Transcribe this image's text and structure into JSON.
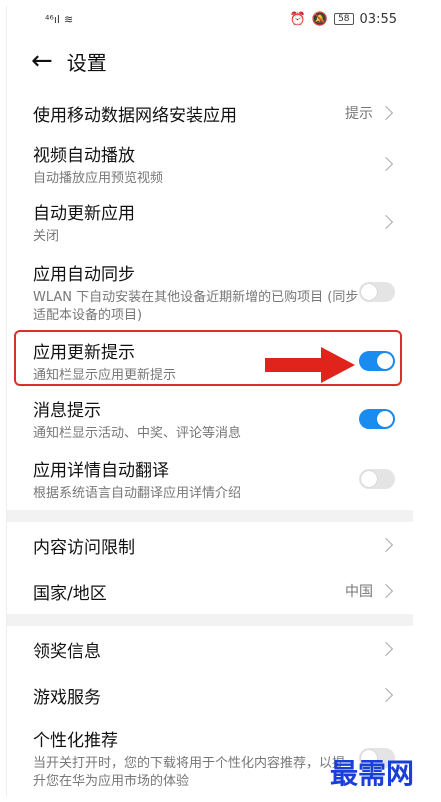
{
  "status": {
    "signal": "⁴⁶ıl",
    "wifi": "≋",
    "battery": "58",
    "time": "03:55"
  },
  "header": {
    "title": "设置"
  },
  "rows": [
    {
      "label": "使用移动数据网络安装应用",
      "value": "提示"
    },
    {
      "label": "视频自动播放",
      "sub": "自动播放应用预览视频"
    },
    {
      "label": "自动更新应用",
      "sub": "关闭"
    },
    {
      "label": "应用自动同步",
      "sub": "WLAN 下自动安装在其他设备近期新增的已购项目 (同步适配本设备的项目)",
      "on": false
    },
    {
      "label": "应用更新提示",
      "sub": "通知栏显示应用更新提示",
      "on": true
    },
    {
      "label": "消息提示",
      "sub": "通知栏显示活动、中奖、评论等消息",
      "on": true
    },
    {
      "label": "应用详情自动翻译",
      "sub": "根据系统语言自动翻译应用详情介绍",
      "on": false
    },
    {
      "label": "内容访问限制"
    },
    {
      "label": "国家/地区",
      "value": "中国"
    },
    {
      "label": "领奖信息"
    },
    {
      "label": "游戏服务"
    },
    {
      "label": "个性化推荐",
      "sub": "当开关打开时，您的下载将用于个性化内容推荐，以提升您在华为应用市场的体验",
      "on": false
    }
  ],
  "watermark": "最需网",
  "colors": {
    "accent": "#1a8cf0",
    "highlight": "#d9302b"
  }
}
